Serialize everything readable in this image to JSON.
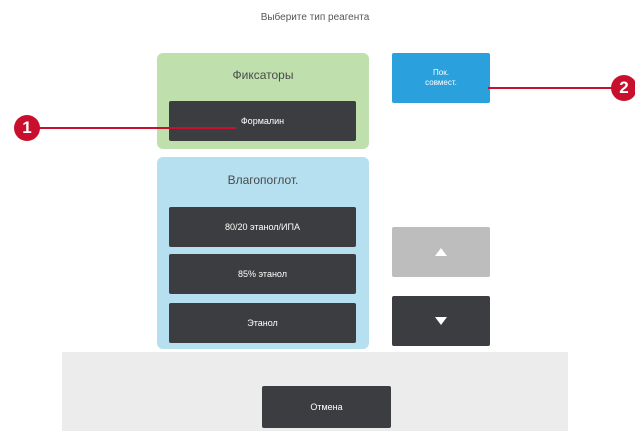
{
  "dialog": {
    "title": "Выберите тип реагента",
    "groups": [
      {
        "label": "Фиксаторы",
        "color": "#bfe0ad",
        "items": [
          "Формалин"
        ]
      },
      {
        "label": "Влагопоглот.",
        "color": "#b6dff0",
        "items": [
          "80/20 этанол/ИПА",
          "85% этанол",
          "Этанол"
        ]
      }
    ],
    "compat_button": {
      "line1": "Пок.",
      "line2": "совмест.",
      "color": "#2aa1dc"
    },
    "scroll_up": {
      "icon": "triangle-up-icon"
    },
    "scroll_down": {
      "icon": "triangle-down-icon"
    },
    "cancel_label": "Отмена"
  },
  "callouts": [
    {
      "number": "1",
      "color": "#c8102e"
    },
    {
      "number": "2",
      "color": "#c8102e"
    }
  ]
}
